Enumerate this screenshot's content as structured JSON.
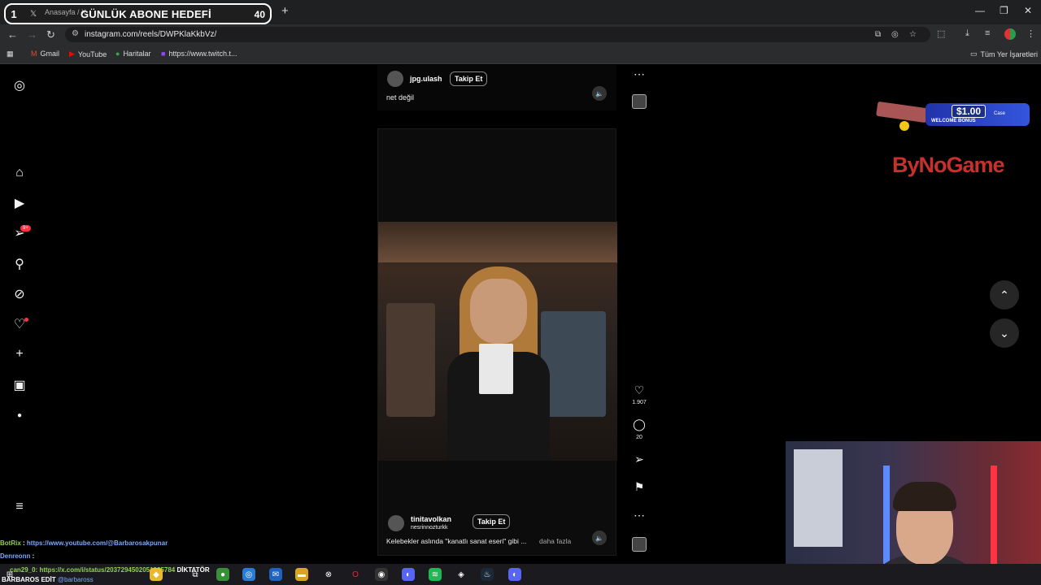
{
  "browser": {
    "tab_title": "Anasayfa / X",
    "overlay_goal": {
      "number": "1",
      "text": "GÜNLÜK ABONE HEDEFİ",
      "count": "40"
    },
    "url": "instagram.com/reels/DWPKlaKkbVz/",
    "bookmarks": [
      {
        "label": "Gmail",
        "icon": "gmail-icon"
      },
      {
        "label": "YouTube",
        "icon": "youtube-icon"
      },
      {
        "label": "Haritalar",
        "icon": "maps-icon"
      },
      {
        "label": "https://www.twitch.t...",
        "icon": "twitch-icon"
      }
    ],
    "all_bookmarks": "Tüm Yer İşaretleri"
  },
  "instagram": {
    "top_reel": {
      "username": "jpg.ulash",
      "follow": "Takip Et",
      "caption": "net değil"
    },
    "main_reel": {
      "username": "tinitavolkan",
      "subuser": "nesrinnozturkk",
      "follow": "Takip Et",
      "caption": "Kelebekler aslında \"kanatlı sanat eseri\" gibi ...",
      "more": "daha fazla",
      "likes": "1.907",
      "comments": "20"
    },
    "badge": "9+"
  },
  "stream": {
    "ad_price": "$1.00",
    "ad_welcome": "WELCOME BONUS",
    "ad_case": "Case",
    "brand": "ByNoGame",
    "chat": [
      {
        "user": "BotRix",
        "text": "https://www.youtube.com/@Barbarosakpunar"
      },
      {
        "user": "Denreonn",
        "text": ""
      },
      {
        "user": "can29_0",
        "text": "can29_0: https://x.com/i/status/2037294502051925784",
        "extra": "DİKTATÖR"
      }
    ],
    "bottom_tag": "BARBAROS EDİT",
    "bottom_handle": "@barbaross"
  }
}
